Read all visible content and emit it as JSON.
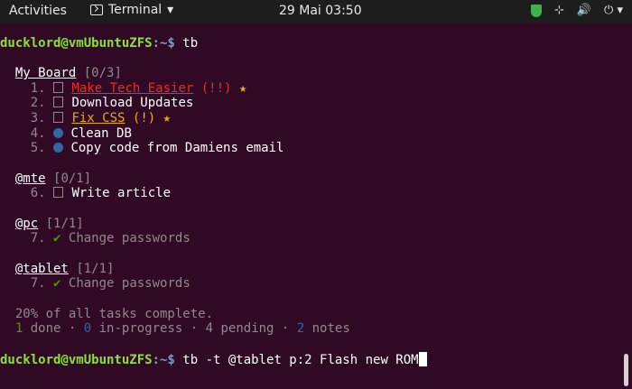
{
  "topbar": {
    "activities": "Activities",
    "app_name": "Terminal",
    "clock": "29 Mai  03:50",
    "network_icon": "network-icon",
    "volume_icon": "volume-icon",
    "power_icon": "power-icon"
  },
  "terminal": {
    "prompt1": {
      "user": "ducklord@vmUbuntuZFS",
      "path": ":~$",
      "command": " tb"
    },
    "boards": [
      {
        "name": "My Board",
        "count": "[0/3]",
        "items": [
          {
            "id": "1.",
            "status": "pending",
            "text": "Make Tech Easier",
            "priority": "(!!)",
            "star": "★"
          },
          {
            "id": "2.",
            "status": "pending",
            "text": "Download Updates"
          },
          {
            "id": "3.",
            "status": "pending",
            "text": "Fix CSS",
            "priority": "(!)",
            "star": "★"
          },
          {
            "id": "4.",
            "status": "note",
            "text": "Clean DB"
          },
          {
            "id": "5.",
            "status": "note",
            "text": "Copy code from Damiens email"
          }
        ]
      },
      {
        "name": "@mte",
        "count": "[0/1]",
        "items": [
          {
            "id": "6.",
            "status": "pending",
            "text": "Write article"
          }
        ]
      },
      {
        "name": "@pc",
        "count": "[1/1]",
        "items": [
          {
            "id": "7.",
            "status": "done",
            "text": "Change passwords"
          }
        ]
      },
      {
        "name": "@tablet",
        "count": "[1/1]",
        "items": [
          {
            "id": "7.",
            "status": "done",
            "text": "Change passwords"
          }
        ]
      }
    ],
    "summary_line1": "20% of all tasks complete.",
    "summary": {
      "done_n": "1",
      "done_label": " done · ",
      "inprog_n": "0",
      "inprog_label": " in-progress · ",
      "pending_n": "4",
      "pending_label": " pending · ",
      "notes_n": "2",
      "notes_label": " notes"
    },
    "prompt2": {
      "user": "ducklord@vmUbuntuZFS",
      "path": ":~$",
      "command": " tb -t @tablet p:2 Flash new ROM"
    },
    "check": "✔"
  }
}
